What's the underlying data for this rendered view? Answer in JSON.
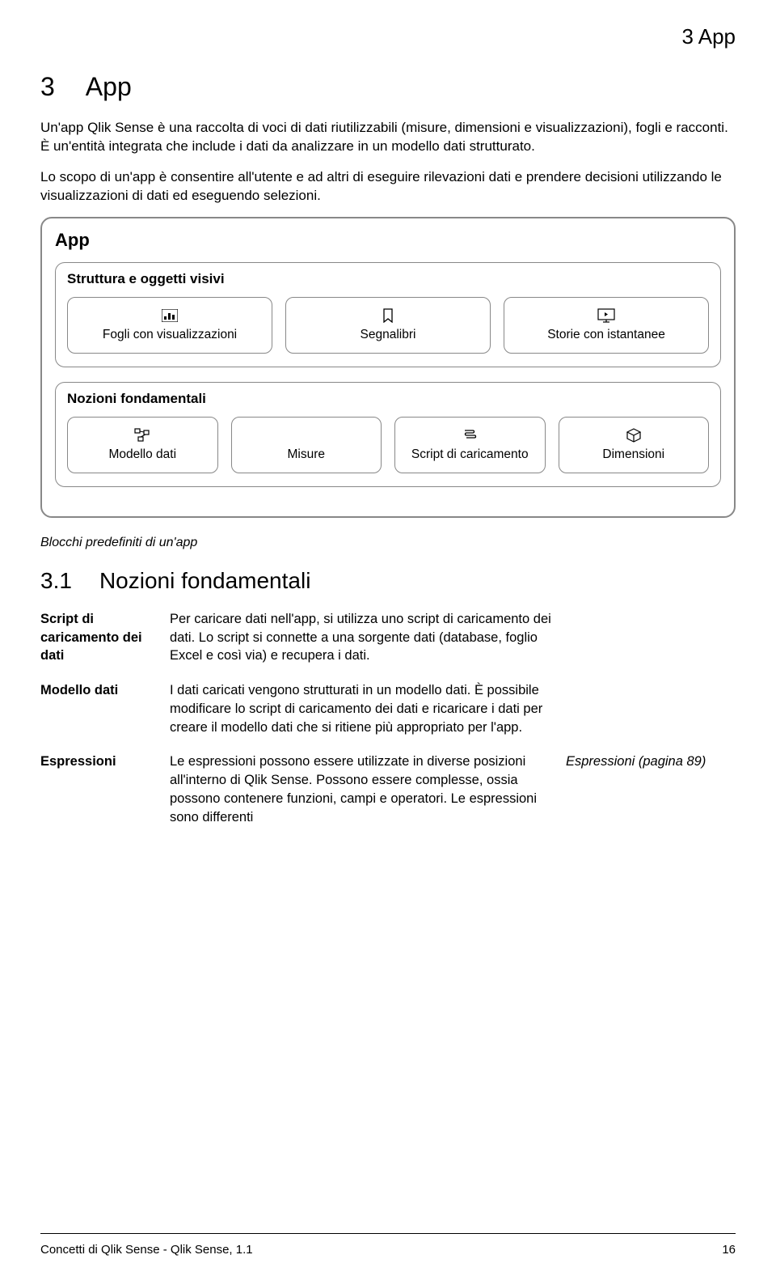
{
  "header": {
    "running_title": "3  App"
  },
  "chapter": {
    "number": "3",
    "title": "App"
  },
  "paragraphs": {
    "p1": "Un'app Qlik Sense è una raccolta di voci di dati riutilizzabili (misure, dimensioni e visualizzazioni), fogli e racconti. È un'entità integrata che include i dati da analizzare in un modello dati strutturato.",
    "p2": "Lo scopo di un'app è consentire all'utente e ad altri di eseguire rilevazioni dati e prendere decisioni utilizzando le visualizzazioni di dati ed eseguendo selezioni."
  },
  "diagram": {
    "title": "App",
    "section1": {
      "title": "Struttura e oggetti visivi",
      "cards": [
        {
          "label": "Fogli con visualizzazioni"
        },
        {
          "label": "Segnalibri"
        },
        {
          "label": "Storie con istantanee"
        }
      ]
    },
    "section2": {
      "title": "Nozioni fondamentali",
      "cards": [
        {
          "label": "Modello dati"
        },
        {
          "label": "Misure"
        },
        {
          "label": "Script di caricamento"
        },
        {
          "label": "Dimensioni"
        }
      ]
    }
  },
  "caption": "Blocchi predefiniti di un'app",
  "subsection": {
    "number": "3.1",
    "title": "Nozioni fondamentali"
  },
  "table": {
    "rows": [
      {
        "term": "Script di caricamento dei dati",
        "desc": "Per caricare dati nell'app, si utilizza uno script di caricamento dei dati. Lo script si connette a una sorgente dati (database, foglio Excel e così via) e recupera i dati.",
        "ref": ""
      },
      {
        "term": "Modello dati",
        "desc": "I dati caricati vengono strutturati in un modello dati. È possibile modificare lo script di caricamento dei dati e ricaricare i dati per creare il modello dati che si ritiene più appropriato per l'app.",
        "ref": ""
      },
      {
        "term": "Espressioni",
        "desc": "Le espressioni possono essere utilizzate in diverse posizioni all'interno di Qlik Sense. Possono essere complesse, ossia possono contenere funzioni, campi e operatori. Le espressioni sono differenti",
        "ref": "Espressioni (pagina 89)"
      }
    ]
  },
  "footer": {
    "left": "Concetti di Qlik Sense - Qlik Sense, 1.1",
    "right": "16"
  }
}
